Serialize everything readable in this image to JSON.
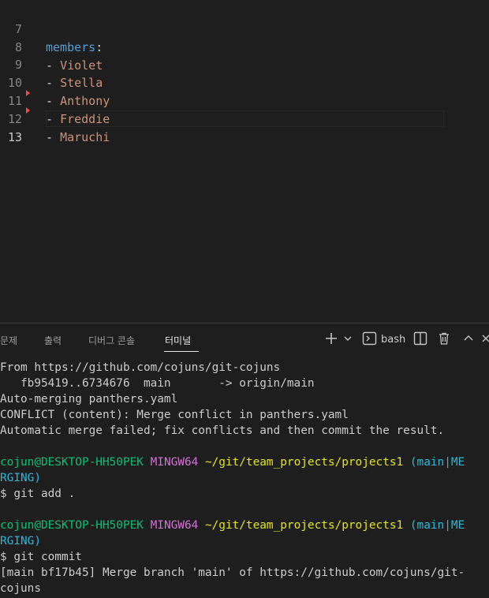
{
  "editor": {
    "lines": [
      {
        "num": "7",
        "key": "members",
        "punct": ":",
        "value": ""
      },
      {
        "num": "8",
        "key": "",
        "punct": "- ",
        "value": "Violet"
      },
      {
        "num": "9",
        "key": "",
        "punct": "- ",
        "value": "Stella"
      },
      {
        "num": "10",
        "key": "",
        "punct": "- ",
        "value": "Anthony"
      },
      {
        "num": "11",
        "key": "",
        "punct": "- ",
        "value": "Freddie"
      },
      {
        "num": "12",
        "key": "",
        "punct": "- ",
        "value": "Maruchi"
      },
      {
        "num": "13",
        "key": "",
        "punct": "",
        "value": ""
      }
    ]
  },
  "panel": {
    "tabs": [
      "문제",
      "출력",
      "디버그 콘솔",
      "터미널"
    ],
    "active_tab": "터미널",
    "shell_label": "bash",
    "icons": [
      "plus-icon",
      "chevron-down-icon",
      "terminal-icon",
      "split-icon",
      "trash-icon",
      "chevron-up-icon",
      "close-icon"
    ]
  },
  "terminal": {
    "l1": "From https://github.com/cojuns/git-cojuns",
    "l2": "   fb95419..6734676  main       -> origin/main",
    "l3": "Auto-merging panthers.yaml",
    "l4": "CONFLICT (content): Merge conflict in panthers.yaml",
    "l5": "Automatic merge failed; fix conflicts and then commit the result.",
    "prompt_user": "cojun@DESKTOP-HH50PEK",
    "prompt_env": "MINGW64",
    "prompt_path": "~/git/team_projects/projects1",
    "prompt_branch_a": "(main|ME",
    "prompt_branch_b": "RGING)",
    "cmd1": "$ git add .",
    "cmd2": "$ git commit",
    "out1": "[main bf17b45] Merge branch 'main' of https://github.com/cojuns/git-",
    "out2": "cojuns"
  }
}
